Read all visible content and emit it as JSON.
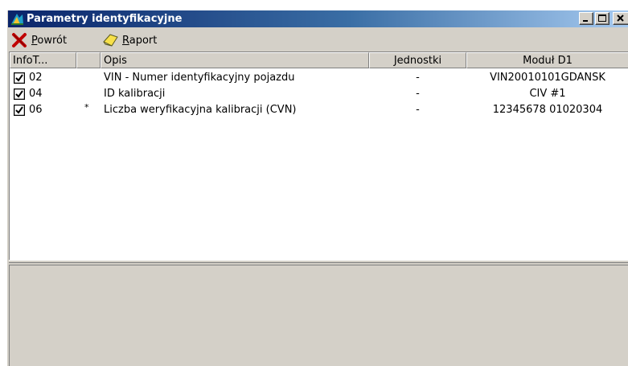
{
  "window": {
    "title": "Parametry identyfikacyjne",
    "colors": {
      "titlebar_start": "#0a246a",
      "titlebar_end": "#a6caf0",
      "face": "#d4d0c8"
    }
  },
  "toolbar": {
    "back_label": "Powrót",
    "back_icon": "red-x-icon",
    "report_label": "Raport",
    "report_icon": "yellow-tag-icon"
  },
  "table": {
    "columns": [
      "InfoT...",
      "",
      "Opis",
      "Jednostki",
      "Moduł D1"
    ],
    "rows": [
      {
        "checked": true,
        "id": "02",
        "flag": "",
        "opis": "VIN - Numer identyfikacyjny pojazdu",
        "jednostki": "-",
        "modul": "VIN20010101GDANSK"
      },
      {
        "checked": true,
        "id": "04",
        "flag": "",
        "opis": "ID kalibracji",
        "jednostki": "-",
        "modul": "CIV #1"
      },
      {
        "checked": true,
        "id": "06",
        "flag": "*",
        "opis": "Liczba weryfikacyjna kalibracji (CVN)",
        "jednostki": "-",
        "modul": "12345678 01020304"
      }
    ]
  }
}
